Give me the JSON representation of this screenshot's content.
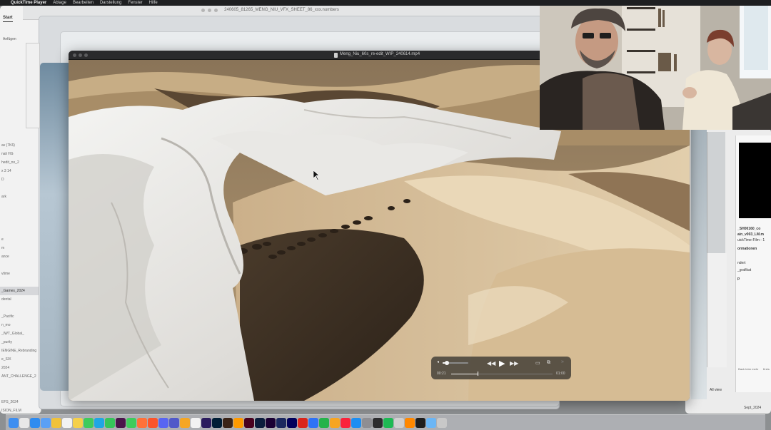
{
  "menubar": {
    "items": [
      "QuickTime Player",
      "Ablage",
      "Bearbeiten",
      "Darstellung",
      "Fenster",
      "Hilfe"
    ]
  },
  "background_windows": {
    "numbers_title": "240605_81265_MENG_NIU_VFX_SHEET_86_xxx.numbers",
    "left_app": {
      "tab": "Start",
      "sub": "Anfügen",
      "list_items": [
        "av (7K6)",
        "nali HG",
        "hedit_no_2",
        "x 3 14",
        "D",
        "",
        "ark",
        "",
        "",
        "",
        "",
        "e",
        "m",
        "ance",
        "",
        "vtime",
        "",
        "_Games_2024",
        "dental",
        "",
        "_Pacific",
        "n_mo",
        "_IWT_Global_",
        "_purity",
        "IENGINE_Rebranding",
        "e_SIX",
        "2024",
        "ANT_CHALLENGE_2",
        "",
        "",
        "EFS_2024",
        "ISION_FILM"
      ],
      "selected_index": 17
    },
    "qt_info_panel": {
      "lines": [
        "_SH00160_co",
        "ain_v003_LM.m",
        "uickTime-Film - 1",
        "ormationen",
        "ndert",
        "_grafikat",
        "p"
      ],
      "buttons": [
        "Back Inter mehr",
        "Kreis"
      ]
    },
    "ext_label": "All view",
    "date_label": "Sept_2024"
  },
  "player": {
    "filename": "Meng_Niu_60s_re-edit_WIP_240614.mp4",
    "time_elapsed": "00:21",
    "time_remaining": "01:00",
    "progress": 0.26,
    "volume": 0.15,
    "icons": {
      "volume": "speaker-icon",
      "rewind": "rewind-icon",
      "play": "play-icon",
      "fast_forward": "fast-forward-icon",
      "airplay": "airplay-icon",
      "pip": "picture-in-picture-icon",
      "more": "more-icon"
    }
  },
  "dock": {
    "apps": [
      "finder",
      "launchpad",
      "safari",
      "mail",
      "chrome",
      "calendar-14",
      "notes",
      "messages",
      "skype",
      "whatsapp",
      "slack",
      "facetime",
      "firefox",
      "brave",
      "discord",
      "teams",
      "photos",
      "calendar",
      "premiere",
      "photoshop",
      "bridge",
      "illustrator",
      "indesign",
      "lightroom-classic",
      "media-encoder",
      "1password",
      "after-effects",
      "acrobat",
      "keynote",
      "numbers",
      "pages",
      "music",
      "app-store",
      "system-settings",
      "activity",
      "spotify",
      "quicktime",
      "vlc",
      "terminal",
      "preview",
      "trash"
    ]
  }
}
